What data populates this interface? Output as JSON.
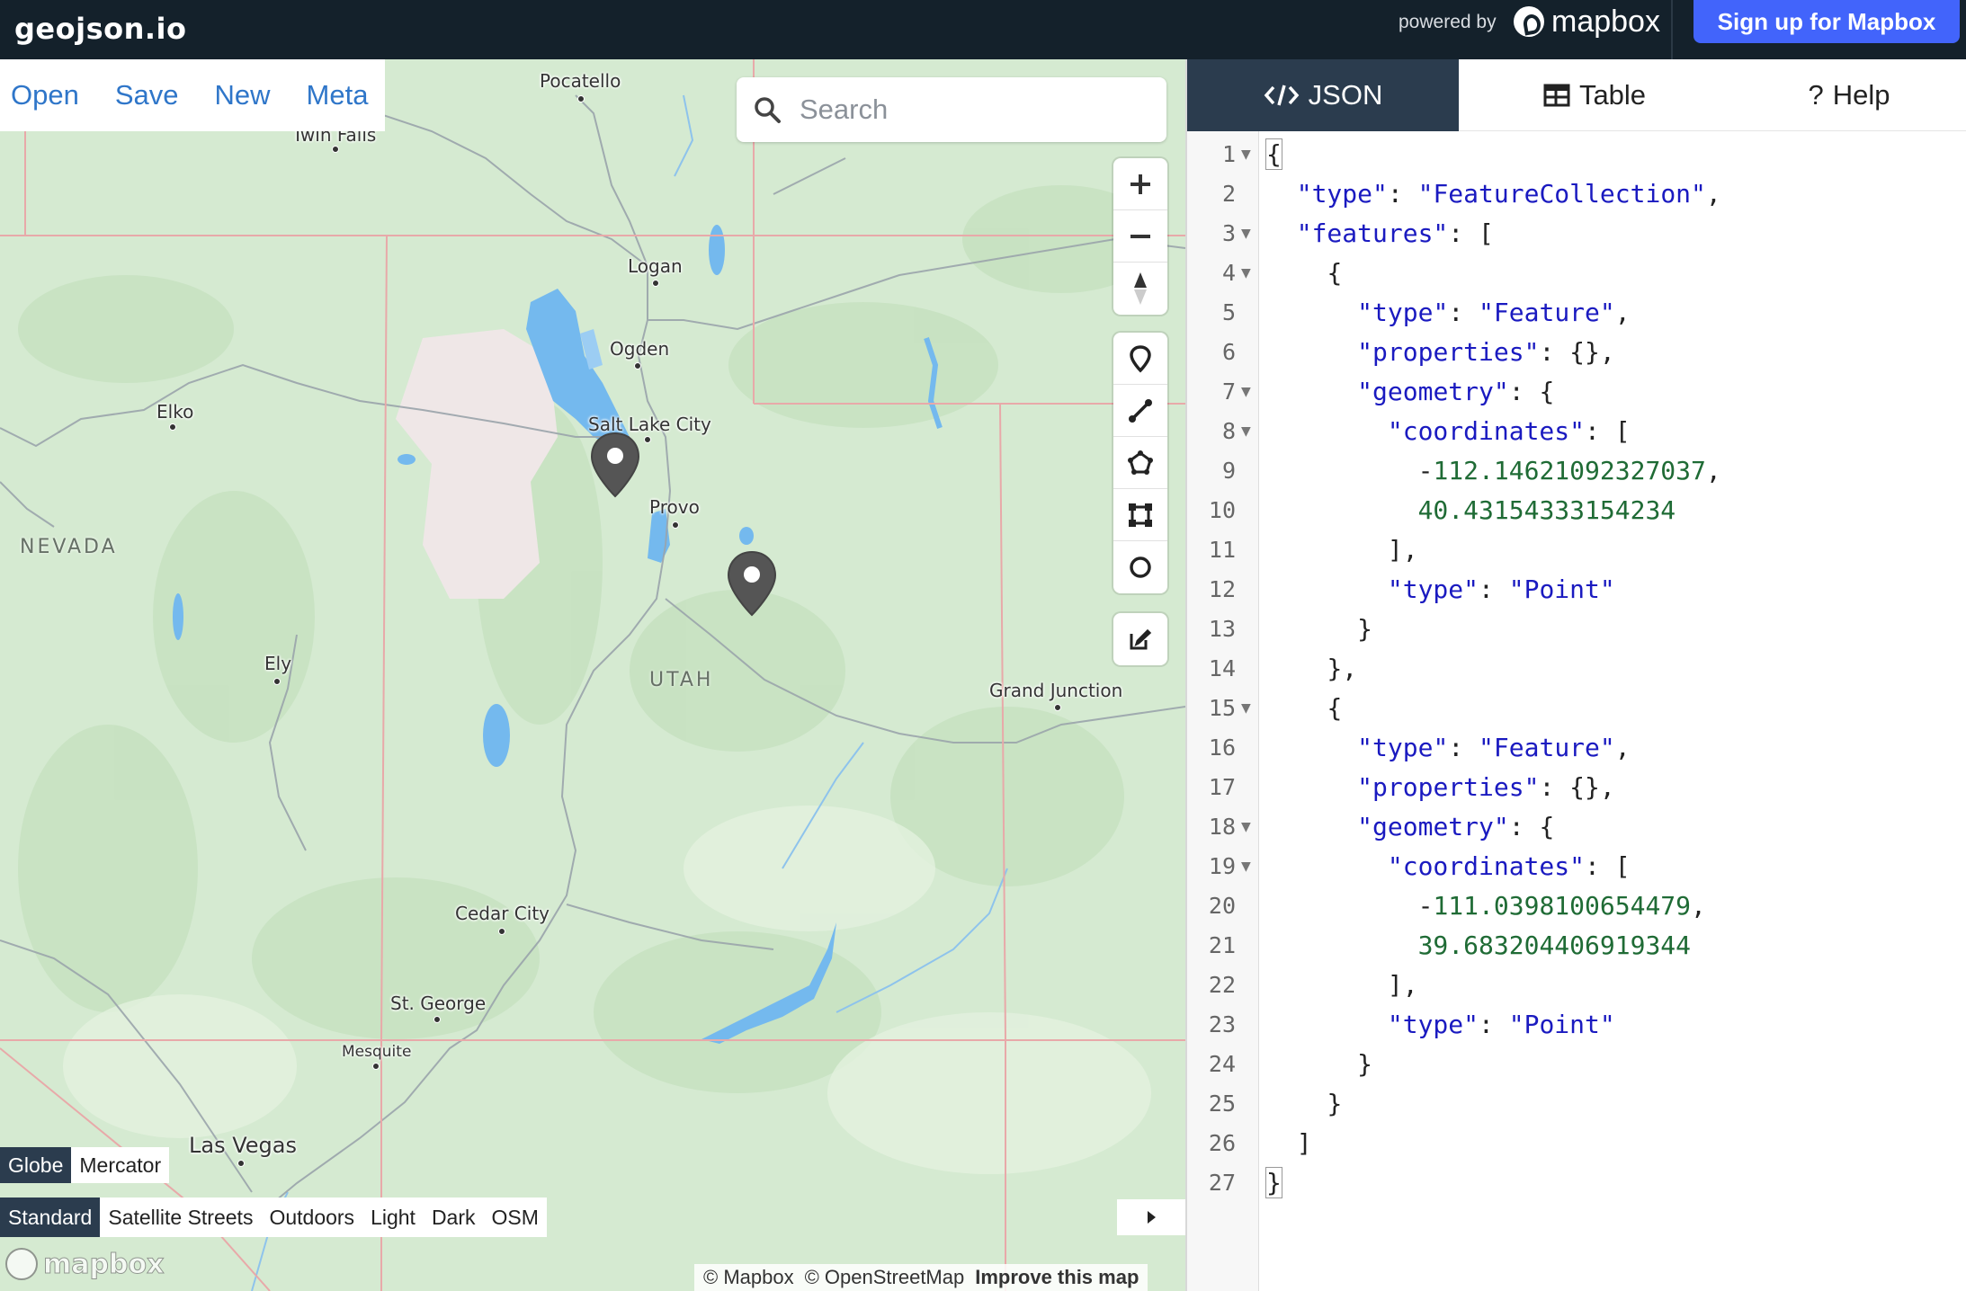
{
  "app": {
    "brand": "geojson.io",
    "powered_by": "powered by",
    "mapbox_logo_text": "mapbox",
    "signup_label": "Sign up for Mapbox"
  },
  "menu": {
    "open": "Open",
    "save": "Save",
    "new": "New",
    "meta": "Meta"
  },
  "search": {
    "placeholder": "Search",
    "icon": "search-icon"
  },
  "map_controls": {
    "zoom": [
      "zoom-in-icon",
      "zoom-out-icon",
      "compass-icon"
    ],
    "draw": [
      "point-marker-icon",
      "line-draw-icon",
      "polygon-draw-icon",
      "rectangle-draw-icon",
      "circle-draw-icon"
    ],
    "edit": "edit-icon"
  },
  "map": {
    "cities": [
      "Pocatello",
      "Twin Falls",
      "Logan",
      "Ogden",
      "Salt Lake City",
      "Provo",
      "Elko",
      "Ely",
      "Grand Junction",
      "Cedar City",
      "St. George",
      "Mesquite",
      "Las Vegas"
    ],
    "states": [
      "NEVADA",
      "UTAH"
    ],
    "markers": 2,
    "colors": {
      "land": "#d5ead1",
      "water": "#74b9ee",
      "salt_flat": "#efe7e7",
      "border": "#e8a9a9",
      "marker": "#555555"
    }
  },
  "projection": {
    "options": [
      "Globe",
      "Mercator"
    ],
    "active": "Globe"
  },
  "styles": {
    "options": [
      "Standard",
      "Satellite Streets",
      "Outdoors",
      "Light",
      "Dark",
      "OSM"
    ],
    "active": "Standard"
  },
  "attribution": {
    "mapbox": "© Mapbox",
    "osm": "© OpenStreetMap",
    "improve": "Improve this map",
    "wordmark": "mapbox"
  },
  "tabs": {
    "json": "JSON",
    "table": "Table",
    "help": "Help",
    "active": "JSON"
  },
  "editor": {
    "line_numbers": [
      "1",
      "2",
      "3",
      "4",
      "5",
      "6",
      "7",
      "8",
      "9",
      "10",
      "11",
      "12",
      "13",
      "14",
      "15",
      "16",
      "17",
      "18",
      "19",
      "20",
      "21",
      "22",
      "23",
      "24",
      "25",
      "26",
      "27"
    ],
    "lines": [
      {
        "indent": "",
        "parts": [
          {
            "t": "{",
            "c": "p bracket"
          }
        ]
      },
      {
        "indent": "  ",
        "parts": [
          {
            "t": "\"type\"",
            "c": "k"
          },
          {
            "t": ": ",
            "c": "p"
          },
          {
            "t": "\"FeatureCollection\"",
            "c": "s"
          },
          {
            "t": ",",
            "c": "p"
          }
        ]
      },
      {
        "indent": "  ",
        "parts": [
          {
            "t": "\"features\"",
            "c": "k"
          },
          {
            "t": ": [",
            "c": "p"
          }
        ]
      },
      {
        "indent": "    ",
        "parts": [
          {
            "t": "{",
            "c": "p"
          }
        ]
      },
      {
        "indent": "      ",
        "parts": [
          {
            "t": "\"type\"",
            "c": "k"
          },
          {
            "t": ": ",
            "c": "p"
          },
          {
            "t": "\"Feature\"",
            "c": "s"
          },
          {
            "t": ",",
            "c": "p"
          }
        ]
      },
      {
        "indent": "      ",
        "parts": [
          {
            "t": "\"properties\"",
            "c": "k"
          },
          {
            "t": ": {},",
            "c": "p"
          }
        ]
      },
      {
        "indent": "      ",
        "parts": [
          {
            "t": "\"geometry\"",
            "c": "k"
          },
          {
            "t": ": {",
            "c": "p"
          }
        ]
      },
      {
        "indent": "        ",
        "parts": [
          {
            "t": "\"coordinates\"",
            "c": "k"
          },
          {
            "t": ": [",
            "c": "p"
          }
        ]
      },
      {
        "indent": "          ",
        "parts": [
          {
            "t": "-",
            "c": "p"
          },
          {
            "t": "112.14621092327037",
            "c": "n"
          },
          {
            "t": ",",
            "c": "p"
          }
        ]
      },
      {
        "indent": "          ",
        "parts": [
          {
            "t": "40.43154333154234",
            "c": "n"
          }
        ]
      },
      {
        "indent": "        ",
        "parts": [
          {
            "t": "],",
            "c": "p"
          }
        ]
      },
      {
        "indent": "        ",
        "parts": [
          {
            "t": "\"type\"",
            "c": "k"
          },
          {
            "t": ": ",
            "c": "p"
          },
          {
            "t": "\"Point\"",
            "c": "s"
          }
        ]
      },
      {
        "indent": "      ",
        "parts": [
          {
            "t": "}",
            "c": "p"
          }
        ]
      },
      {
        "indent": "    ",
        "parts": [
          {
            "t": "},",
            "c": "p"
          }
        ]
      },
      {
        "indent": "    ",
        "parts": [
          {
            "t": "{",
            "c": "p"
          }
        ]
      },
      {
        "indent": "      ",
        "parts": [
          {
            "t": "\"type\"",
            "c": "k"
          },
          {
            "t": ": ",
            "c": "p"
          },
          {
            "t": "\"Feature\"",
            "c": "s"
          },
          {
            "t": ",",
            "c": "p"
          }
        ]
      },
      {
        "indent": "      ",
        "parts": [
          {
            "t": "\"properties\"",
            "c": "k"
          },
          {
            "t": ": {},",
            "c": "p"
          }
        ]
      },
      {
        "indent": "      ",
        "parts": [
          {
            "t": "\"geometry\"",
            "c": "k"
          },
          {
            "t": ": {",
            "c": "p"
          }
        ]
      },
      {
        "indent": "        ",
        "parts": [
          {
            "t": "\"coordinates\"",
            "c": "k"
          },
          {
            "t": ": [",
            "c": "p"
          }
        ]
      },
      {
        "indent": "          ",
        "parts": [
          {
            "t": "-",
            "c": "p"
          },
          {
            "t": "111.0398100654479",
            "c": "n"
          },
          {
            "t": ",",
            "c": "p"
          }
        ]
      },
      {
        "indent": "          ",
        "parts": [
          {
            "t": "39.683204406919344",
            "c": "n"
          }
        ]
      },
      {
        "indent": "        ",
        "parts": [
          {
            "t": "],",
            "c": "p"
          }
        ]
      },
      {
        "indent": "        ",
        "parts": [
          {
            "t": "\"type\"",
            "c": "k"
          },
          {
            "t": ": ",
            "c": "p"
          },
          {
            "t": "\"Point\"",
            "c": "s"
          }
        ]
      },
      {
        "indent": "      ",
        "parts": [
          {
            "t": "}",
            "c": "p"
          }
        ]
      },
      {
        "indent": "    ",
        "parts": [
          {
            "t": "}",
            "c": "p"
          }
        ]
      },
      {
        "indent": "  ",
        "parts": [
          {
            "t": "]",
            "c": "p"
          }
        ]
      },
      {
        "indent": "",
        "parts": [
          {
            "t": "}",
            "c": "p bracket"
          }
        ]
      }
    ],
    "foldable_lines": [
      1,
      3,
      4,
      7,
      8,
      15,
      18,
      19
    ]
  }
}
